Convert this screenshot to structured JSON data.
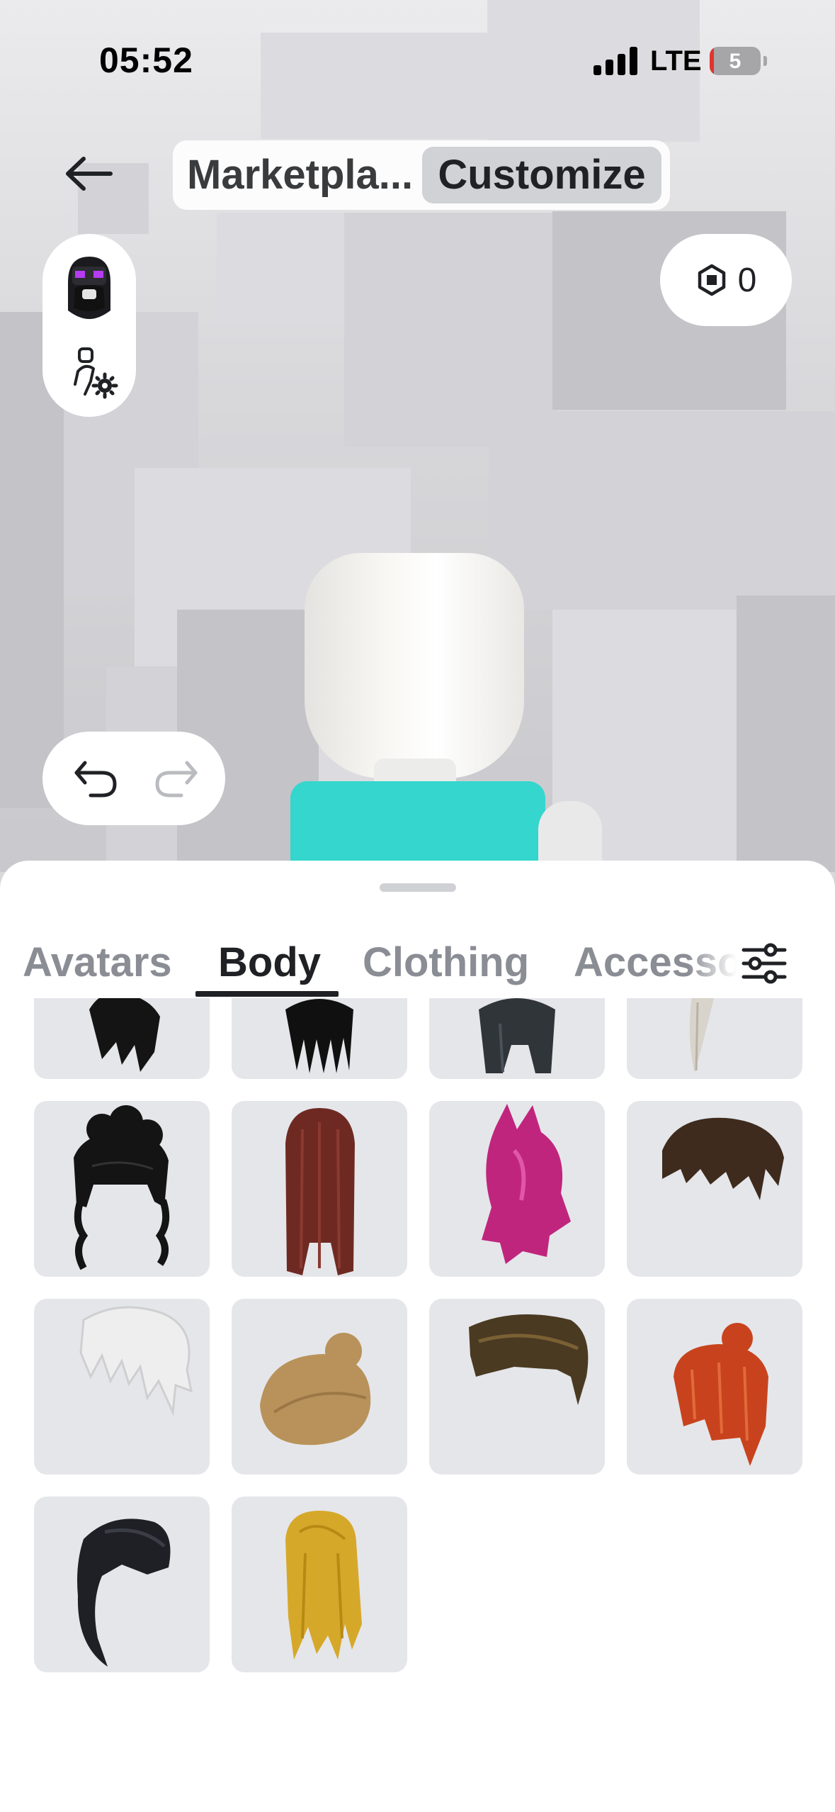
{
  "status_bar": {
    "time": "05:52",
    "network": "LTE",
    "battery": "5"
  },
  "header": {
    "modes": [
      "Marketpla...",
      "Customize"
    ],
    "active_mode": "Customize",
    "robux_balance": "0"
  },
  "tabs": [
    "Avatars",
    "Body",
    "Clothing",
    "Accesso"
  ],
  "active_tab": "Body",
  "items": [
    {
      "name": "black-hair-item",
      "color": "#141414"
    },
    {
      "name": "black-straight-hair-item",
      "color": "#101010"
    },
    {
      "name": "dark-gray-hair-item",
      "color": "#30353a"
    },
    {
      "name": "white-ponytail-hair-item",
      "color": "#d8d4cc"
    },
    {
      "name": "black-curly-hair-item",
      "color": "#141414"
    },
    {
      "name": "auburn-long-hair-item",
      "color": "#6e2a22"
    },
    {
      "name": "pink-cat-hair-item",
      "color": "#c0257d"
    },
    {
      "name": "brown-messy-hair-item",
      "color": "#3e2b1d"
    },
    {
      "name": "white-spiky-hair-item",
      "color": "#eeeeee"
    },
    {
      "name": "blonde-bun-hair-item",
      "color": "#b8925a"
    },
    {
      "name": "brown-slick-hair-item",
      "color": "#4a3a22"
    },
    {
      "name": "red-bun-hair-item",
      "color": "#c8431d"
    },
    {
      "name": "black-ponytail-hair-item",
      "color": "#1e2026"
    },
    {
      "name": "golden-long-hair-item",
      "color": "#d6a82a"
    }
  ],
  "colors": {
    "accent": "#1f2124",
    "tile_bg": "#e5e6ea",
    "torso": "#34d6cd",
    "muted_tab": "#8a8d94"
  }
}
